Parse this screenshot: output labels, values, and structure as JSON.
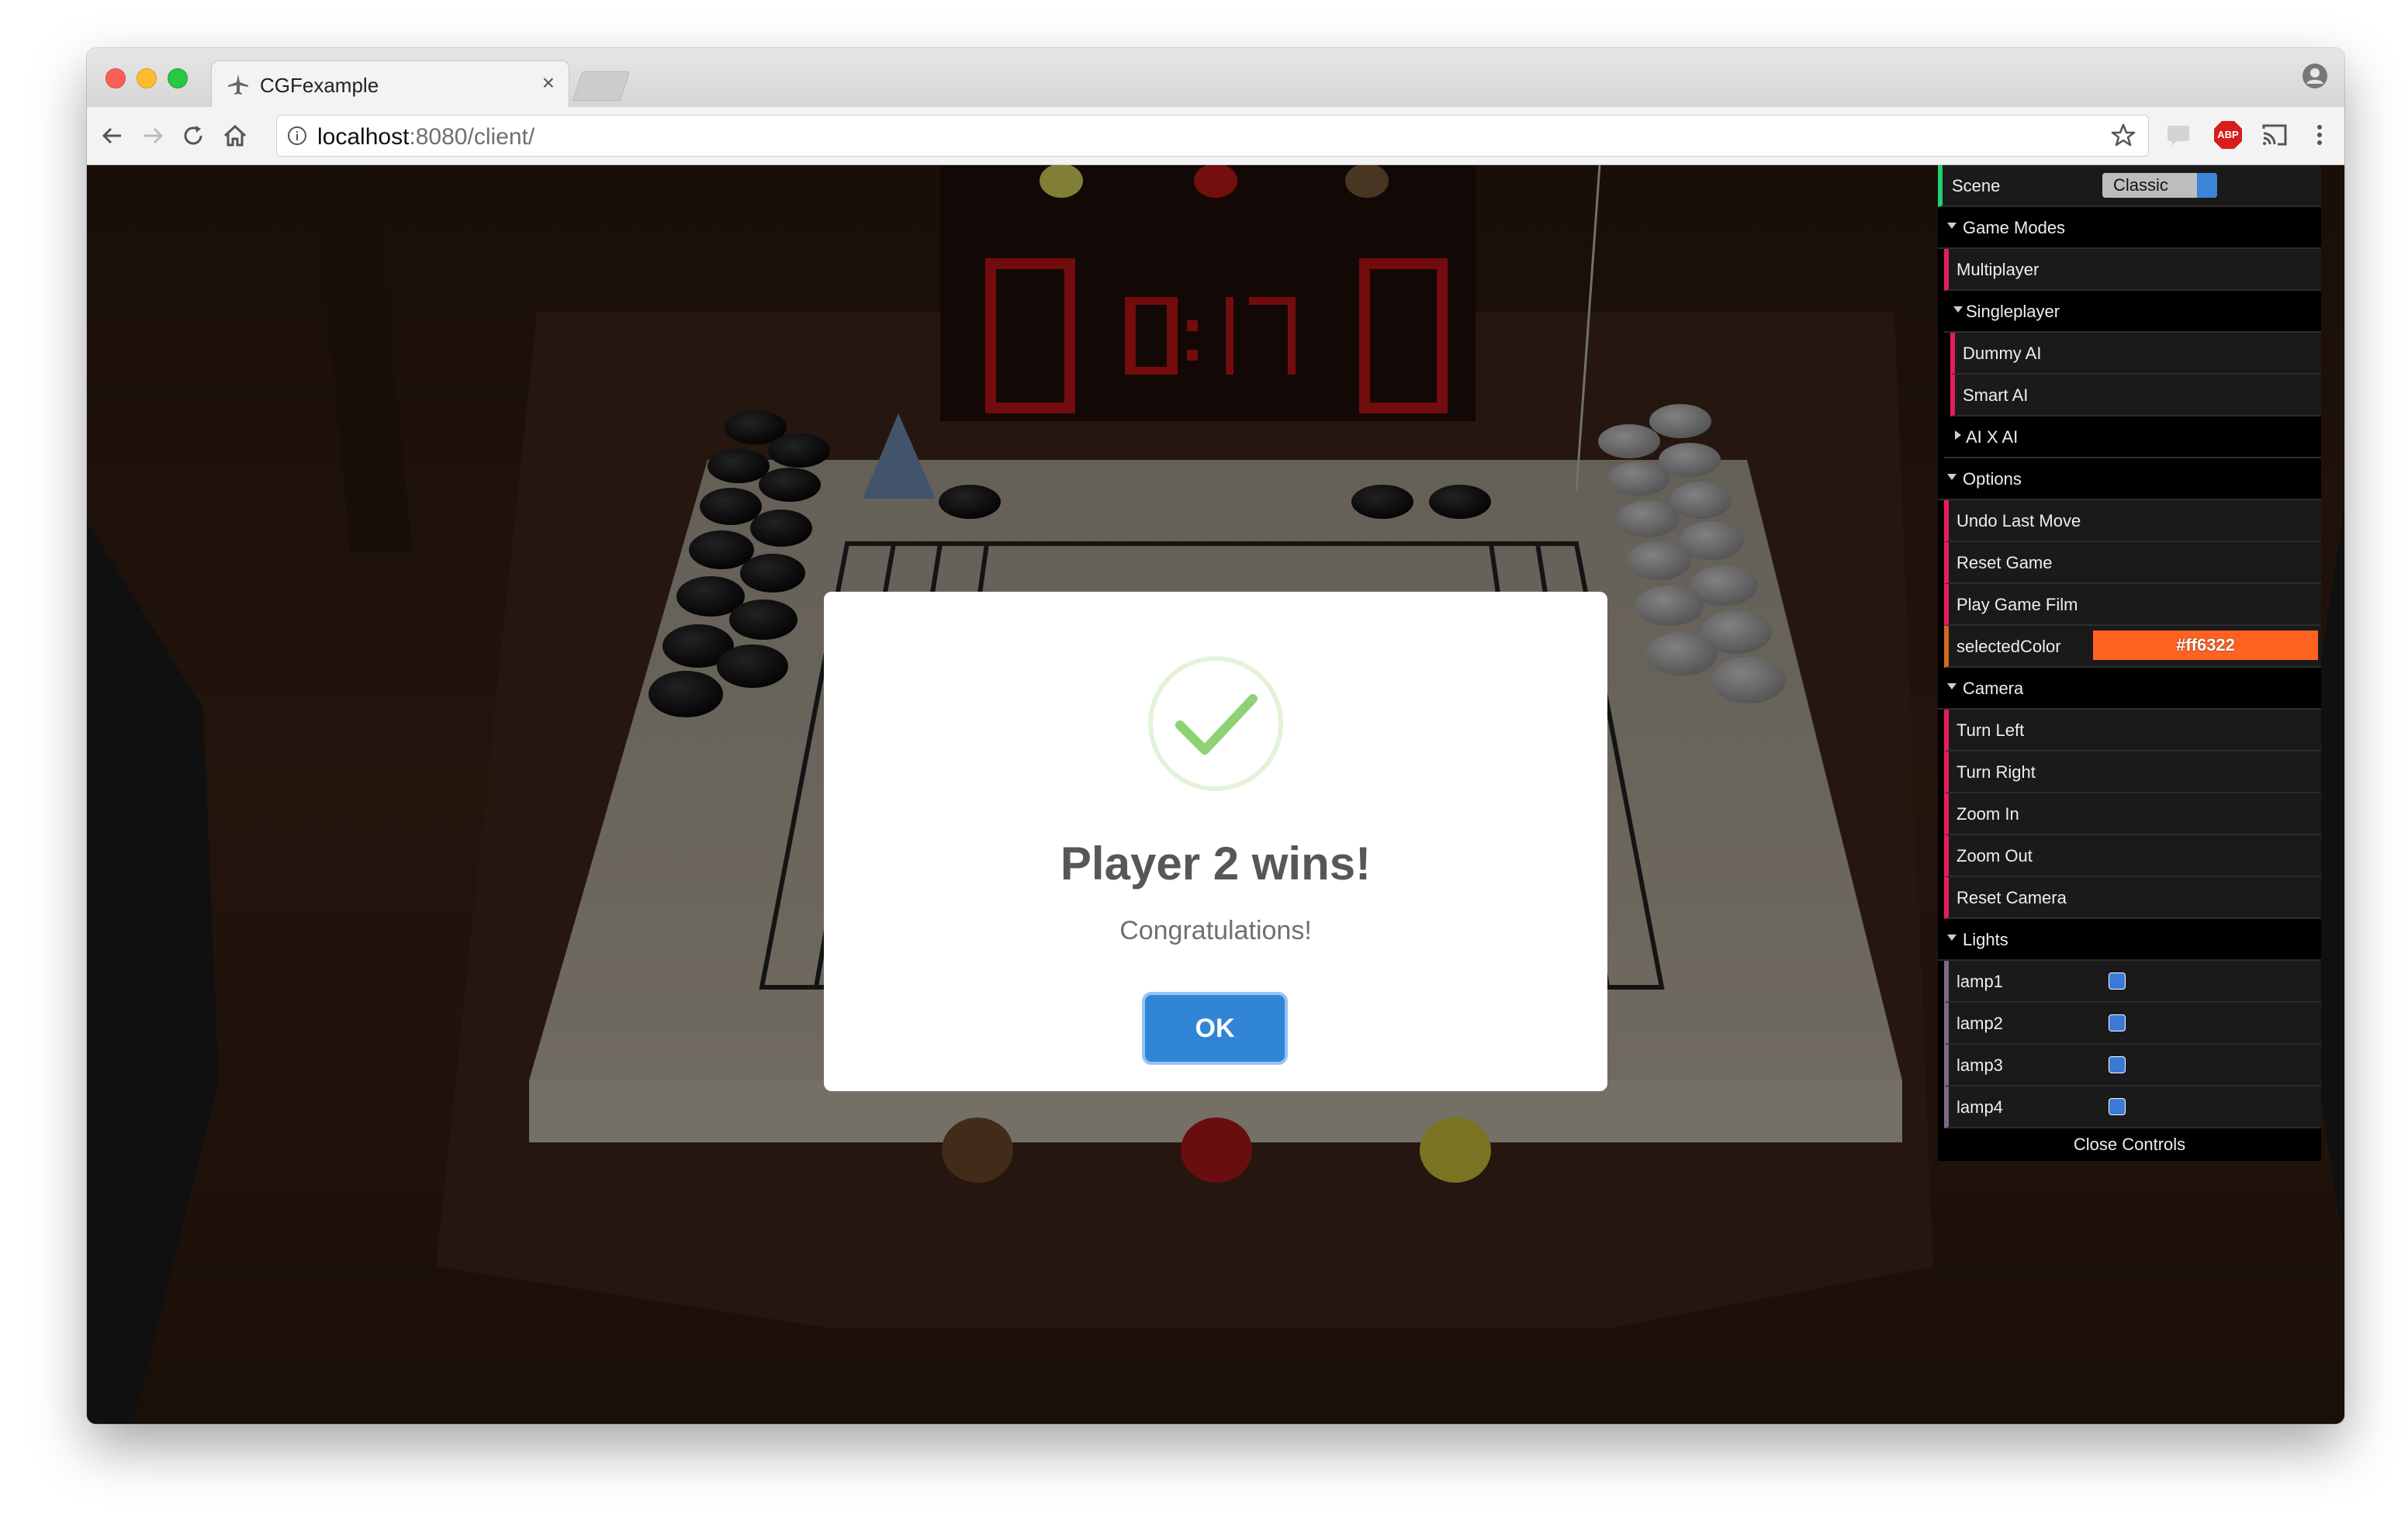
{
  "browser": {
    "tab_title": "CGFexample",
    "tab_close": "×",
    "url_host": "localhost",
    "url_path": ":8080/client/",
    "abp_label": "ABP"
  },
  "dialog": {
    "title": "Player 2 wins!",
    "message": "Congratulations!",
    "ok_label": "OK"
  },
  "gui": {
    "scene_label": "Scene",
    "scene_value": "Classic",
    "game_modes": "Game Modes",
    "multiplayer": "Multiplayer",
    "singleplayer": "Singleplayer",
    "dummy_ai": "Dummy AI",
    "smart_ai": "Smart AI",
    "ai_x_ai": "AI X AI",
    "options": "Options",
    "undo": "Undo Last Move",
    "reset_game": "Reset Game",
    "play_film": "Play Game Film",
    "selected_color_label": "selectedColor",
    "selected_color_value": "#ff6322",
    "camera": "Camera",
    "turn_left": "Turn Left",
    "turn_right": "Turn Right",
    "zoom_in": "Zoom In",
    "zoom_out": "Zoom Out",
    "reset_camera": "Reset Camera",
    "lights": "Lights",
    "lamps": [
      "lamp1",
      "lamp2",
      "lamp3",
      "lamp4"
    ],
    "lamps_checked": [
      true,
      true,
      true,
      true
    ],
    "close_controls": "Close Controls"
  },
  "colors": {
    "accent_blue": "#3085d6",
    "selected_color": "#ff6322",
    "gui_border_green": "#2fa1d6",
    "gui_border_red": "#e61d5f",
    "timer_red": "#e01818"
  },
  "icons": {
    "favicon": "airplane-icon",
    "back": "arrow-left-icon",
    "forward": "arrow-right-icon",
    "reload": "reload-icon",
    "home": "home-icon",
    "info": "info-icon",
    "star": "star-icon",
    "profile": "profile-icon",
    "success": "checkmark-icon"
  }
}
